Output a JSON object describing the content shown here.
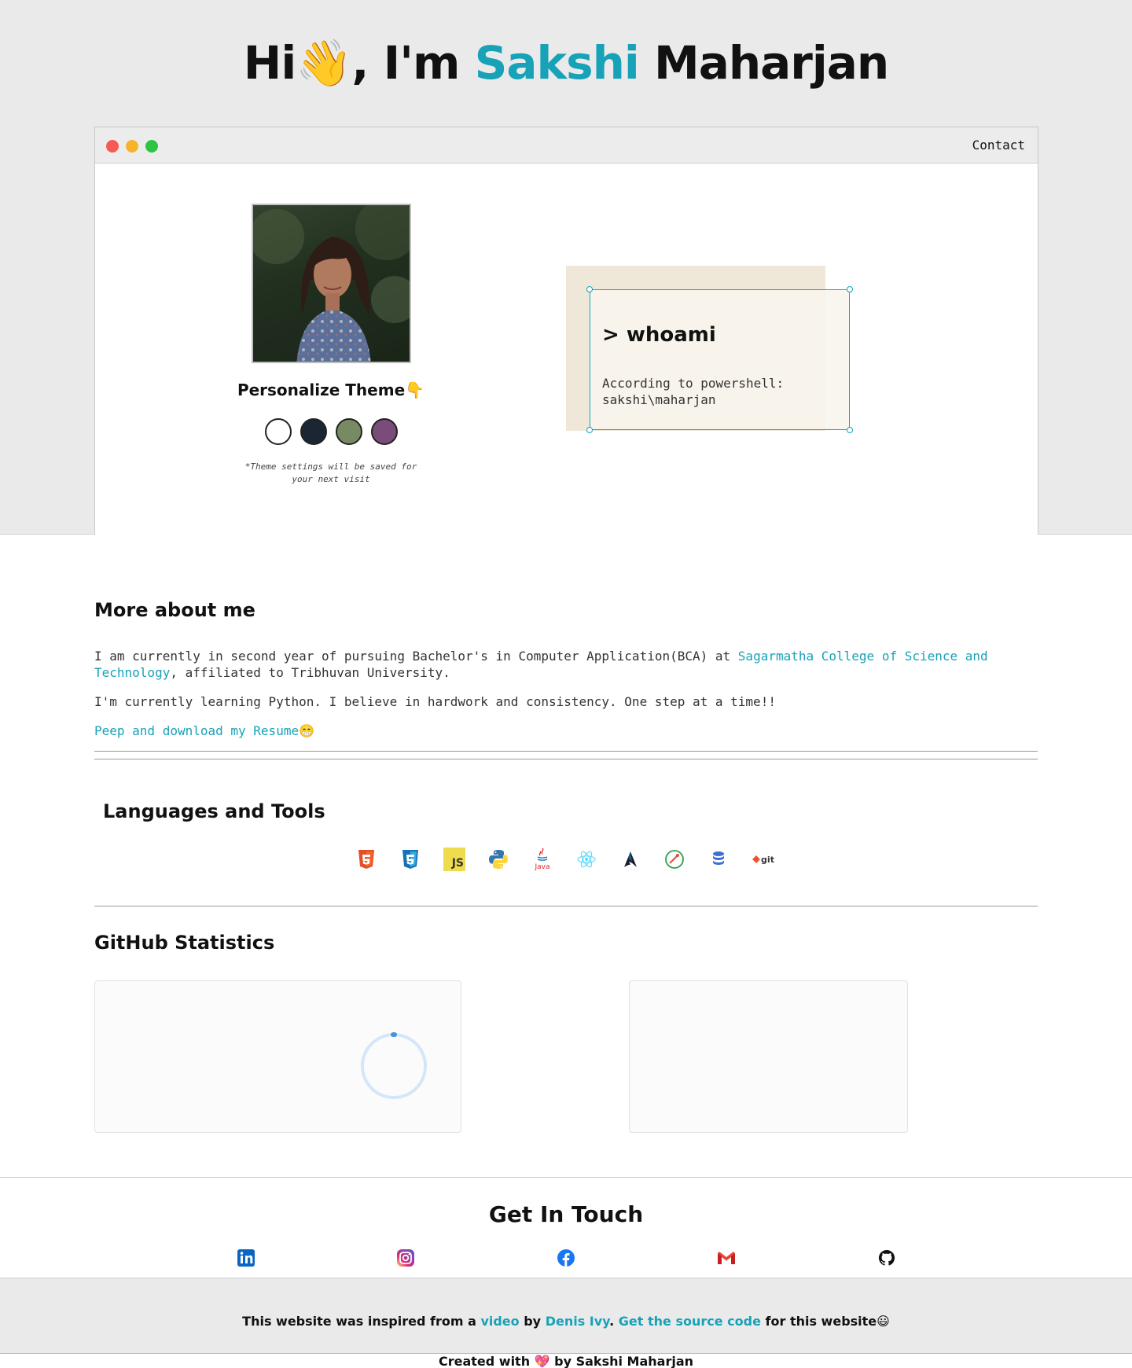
{
  "hero": {
    "greeting": "Hi",
    "wave_emoji": "👋",
    "middle": ", I'm ",
    "first_name": "Sakshi",
    "last_name": " Maharjan"
  },
  "browser": {
    "nav_contact": "Contact"
  },
  "theme": {
    "title": "Personalize Theme👇",
    "swatches": [
      "#ffffff",
      "#1b2633",
      "#788a62",
      "#7a4c7a"
    ],
    "note": "*Theme settings will be saved for your next visit"
  },
  "whoami": {
    "title": "> whoami",
    "line1": "According to powershell:",
    "line2": "sakshi\\maharjan"
  },
  "about": {
    "title": "More about me",
    "p1_before": "I am currently in second year of pursuing Bachelor's in Computer Application(BCA) at ",
    "p1_link": "Sagarmatha College of Science and Technology",
    "p1_after": ", affiliated to Tribhuvan University.",
    "p2": "I'm currently learning Python. I believe in hardwork and consistency. One step at a time!!",
    "resume_link": "Peep and download my Resume",
    "resume_emoji": "😁"
  },
  "tools": {
    "title": "Languages and Tools",
    "items": [
      "html5-icon",
      "css3-icon",
      "javascript-icon",
      "python-icon",
      "java-icon",
      "react-icon",
      "arch-linux-icon",
      "postman-icon",
      "database-icon",
      "git-icon"
    ],
    "js_label": "JS",
    "java_label": "Java",
    "git_label": "git"
  },
  "github": {
    "title": "GitHub Statistics"
  },
  "contact": {
    "title": "Get In Touch",
    "socials": [
      "linkedin-icon",
      "instagram-icon",
      "facebook-icon",
      "gmail-icon",
      "github-icon"
    ]
  },
  "footer": {
    "text_before": "This website was inspired from a ",
    "video_link": "video",
    "by": " by ",
    "author_link": "Denis Ivy",
    "dot": ". ",
    "source_link": "Get the source code",
    "text_after": " for this website😃",
    "created": "Created with 💖 by Sakshi Maharjan"
  },
  "colors": {
    "accent": "#17a2b8",
    "hero_bg": "#eaeaeb"
  }
}
